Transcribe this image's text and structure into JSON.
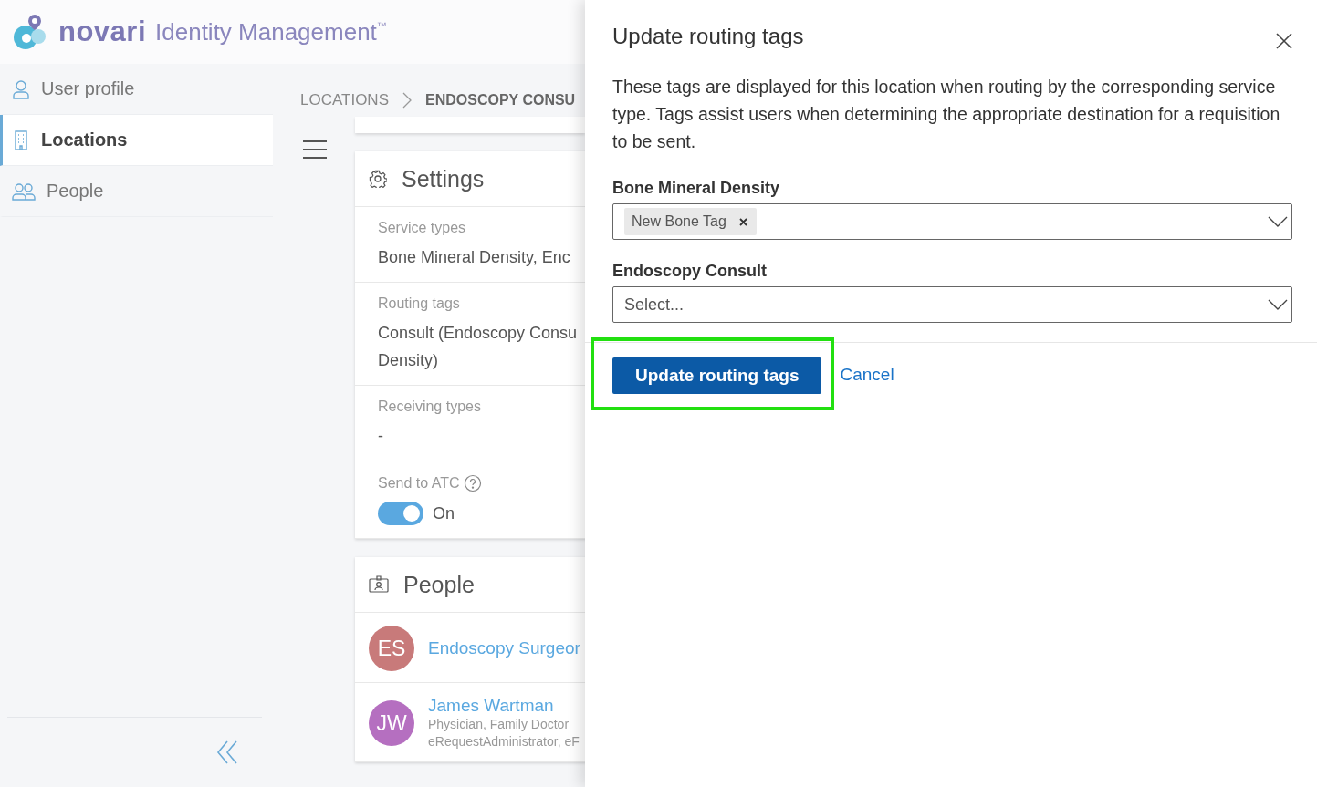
{
  "header": {
    "brand": "novari",
    "product": "Identity Management",
    "trademark": "™"
  },
  "sidebar": {
    "items": [
      {
        "label": "User profile",
        "kind": "user",
        "selected": false
      },
      {
        "label": "Locations",
        "kind": "building",
        "selected": true
      },
      {
        "label": "People",
        "kind": "people",
        "selected": false
      }
    ]
  },
  "breadcrumb": [
    "LOCATIONS",
    "ENDOSCOPY CONSU"
  ],
  "settings": {
    "title": "Settings",
    "fields": [
      {
        "kind": "text",
        "label": "Service types",
        "lines": [
          "Bone Mineral Density, Enc"
        ]
      },
      {
        "kind": "text",
        "label": "Routing tags",
        "lines": [
          "Consult (Endoscopy Consu",
          "Density)"
        ]
      },
      {
        "kind": "text",
        "label": "Receiving types",
        "lines": [
          "-"
        ]
      },
      {
        "kind": "toggle",
        "label": "Send to ATC",
        "on": true,
        "value": "On"
      }
    ]
  },
  "people": {
    "title": "People",
    "items": [
      {
        "initials": "ES",
        "color": "#c87a7a",
        "name": "Endoscopy Surgeor"
      },
      {
        "initials": "JW",
        "color": "#b56fc0",
        "name": "James Wartman",
        "details": [
          "Physician, Family Doctor",
          "eRequestAdministrator, eF"
        ]
      }
    ]
  },
  "panel": {
    "title": "Update routing tags",
    "description": "These tags are displayed for this location when routing by the corresponding service type. Tags assist users when determining the appropriate destination for a requisition to be sent.",
    "fields": [
      {
        "label": "Bone Mineral Density",
        "tags": [
          "New Bone Tag"
        ]
      },
      {
        "label": "Endoscopy Consult",
        "placeholder": "Select..."
      }
    ],
    "primary_button": "Update routing tags",
    "cancel": "Cancel"
  }
}
